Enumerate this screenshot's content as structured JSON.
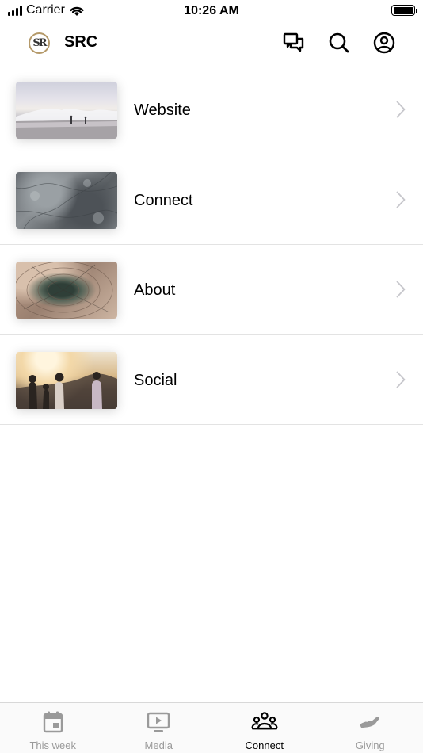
{
  "status_bar": {
    "carrier": "Carrier",
    "time": "10:26 AM",
    "icons": [
      "signal-icon",
      "wifi-icon",
      "battery-icon"
    ]
  },
  "header": {
    "logo_text": "SR",
    "title": "SRC",
    "actions": [
      "chat-icon",
      "search-icon",
      "profile-icon"
    ]
  },
  "list": {
    "items": [
      {
        "label": "Website",
        "thumbnail": "beach-waves-photo"
      },
      {
        "label": "Connect",
        "thumbnail": "stone-texture-photo"
      },
      {
        "label": "About",
        "thumbnail": "tree-rings-photo"
      },
      {
        "label": "Social",
        "thumbnail": "friends-sunset-photo"
      }
    ]
  },
  "tab_bar": {
    "active": "Connect",
    "tabs": [
      {
        "label": "This week",
        "icon": "calendar-icon"
      },
      {
        "label": "Media",
        "icon": "tv-play-icon"
      },
      {
        "label": "Connect",
        "icon": "people-group-icon"
      },
      {
        "label": "Giving",
        "icon": "hand-giving-icon"
      }
    ]
  },
  "colors": {
    "active_tab": "#000000",
    "inactive_tab": "#9a9a9a",
    "divider": "#e3e3e3",
    "logo_ring": "#b59a6a"
  }
}
